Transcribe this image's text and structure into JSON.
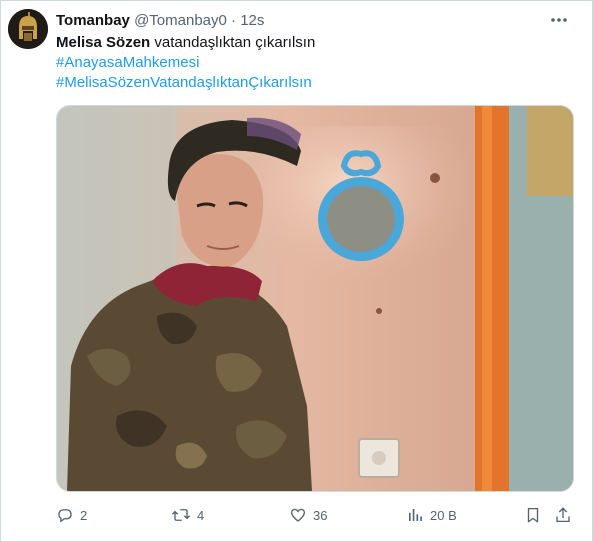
{
  "tweet": {
    "display_name": "Tomanbay",
    "handle": "@Tomanbay0",
    "separator": "·",
    "time": "12s",
    "text_bold": "Melisa Sözen",
    "text_rest": " vatandaşlıktan çıkarılsın",
    "hashtags": [
      "#AnayasaMahkemesi",
      "#MelisaSözenVatandaşlıktanÇıkarılsın"
    ]
  },
  "icons": {
    "avatar": "helmet-avatar",
    "more": "more-icon",
    "reply": "reply-icon",
    "retweet": "retweet-icon",
    "like": "heart-icon",
    "views": "views-icon",
    "bookmark": "bookmark-icon",
    "share": "share-icon"
  },
  "actions": {
    "replies": "2",
    "retweets": "4",
    "likes": "36",
    "views": "20 B"
  },
  "colors": {
    "text": "#0f1419",
    "muted": "#536471",
    "link": "#1d9bf0",
    "border": "#cfd9de"
  }
}
